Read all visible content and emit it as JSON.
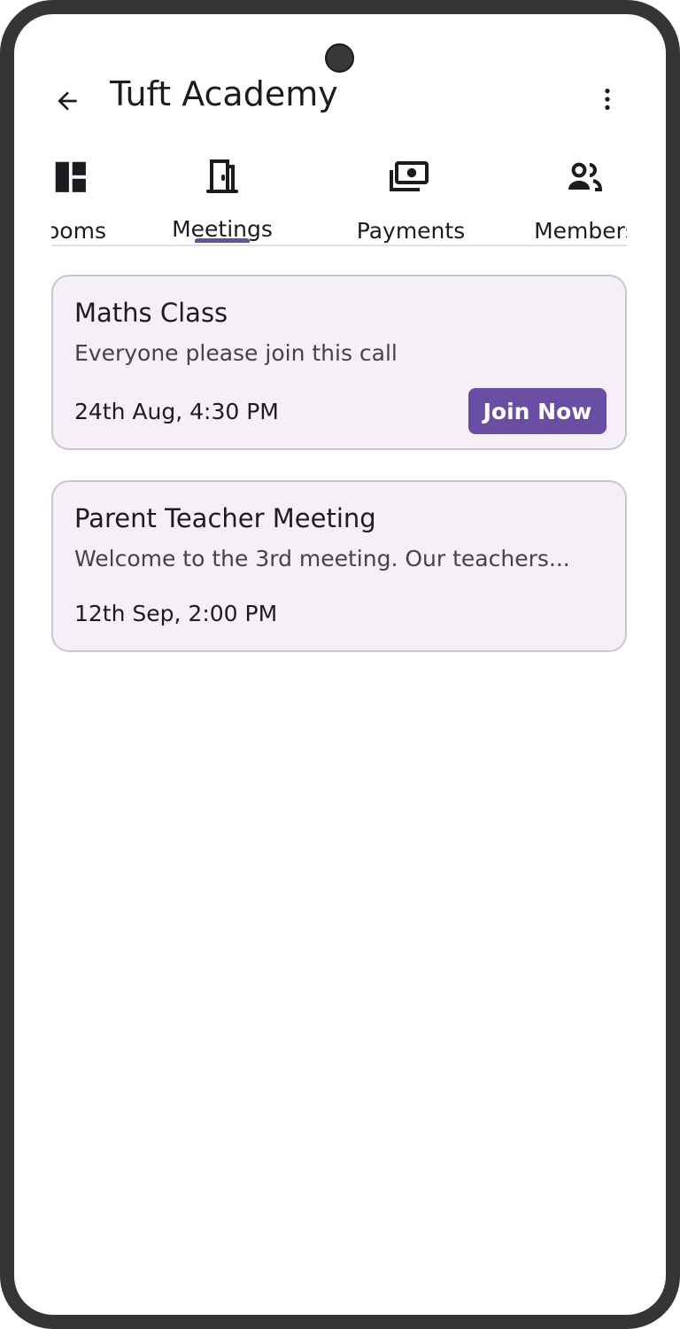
{
  "app": {
    "title": "Tuft Academy"
  },
  "icons": {
    "back": "arrow-left-icon",
    "more": "more-vert-icon"
  },
  "tabs": [
    {
      "label": "Rooms",
      "visible_label": "ooms",
      "icon": "dashboard-icon",
      "selected": false
    },
    {
      "label": "Meetings",
      "icon": "door-icon",
      "selected": true
    },
    {
      "label": "Payments",
      "icon": "payments-icon",
      "selected": false
    },
    {
      "label": "Members",
      "icon": "group-icon",
      "selected": false
    }
  ],
  "meetings": [
    {
      "title": "Maths Class",
      "description": "Everyone please join this call",
      "time": "24th Aug, 4:30 PM",
      "action_label": "Join Now"
    },
    {
      "title": "Parent Teacher Meeting",
      "description": "Welcome to the 3rd meeting. Our teachers...",
      "time": "12th Sep, 2:00 PM"
    }
  ],
  "colors": {
    "accent": "#6750a4",
    "button": "#6a4ea3",
    "card_bg": "#f5f0f8",
    "card_border": "#cac4d0",
    "frame": "#353535"
  }
}
